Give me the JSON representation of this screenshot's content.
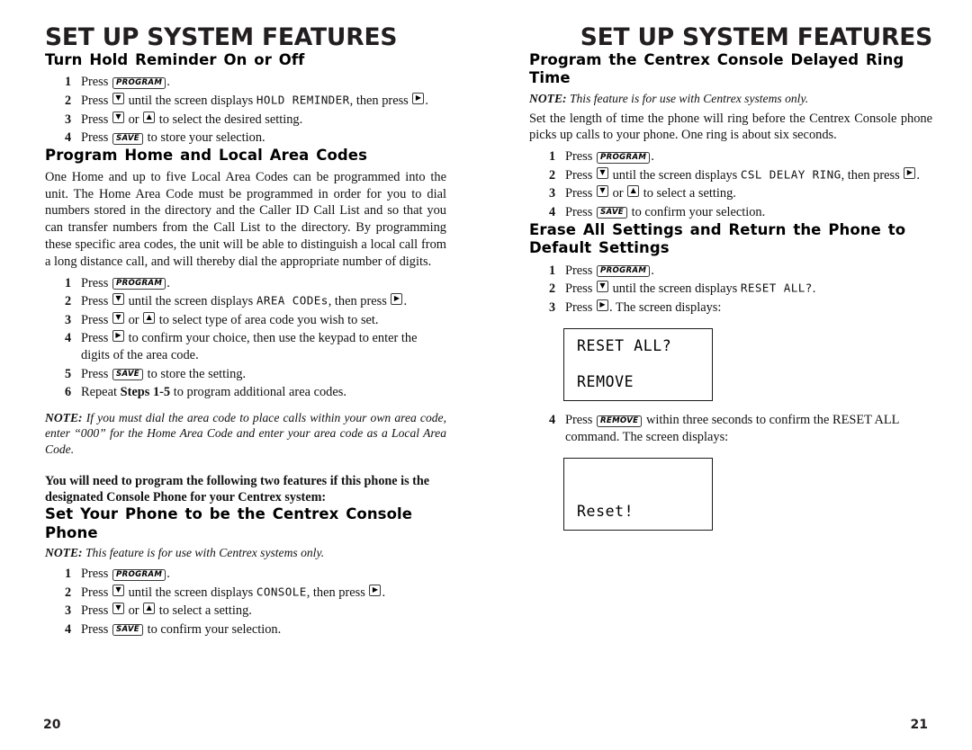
{
  "spread": {
    "left_page": {
      "running_head": "SET UP SYSTEM FEATURES",
      "folio": "20",
      "sections": [
        {
          "heading": "Turn Hold Reminder On or Off",
          "steps": [
            {
              "num": "1",
              "pre": "Press ",
              "key1": "PROGRAM",
              "mid": ".",
              "key2": "",
              "post": ""
            },
            {
              "num": "2",
              "pre": "Press ",
              "arrow": "down",
              "mid": " until the screen displays ",
              "lcd": "HOLD  REMINDER",
              "post": ", then press ",
              "arrow2": "right",
              "end": "."
            },
            {
              "num": "3",
              "pre": "Press ",
              "arrow": "down",
              "mid": " or ",
              "arrow2": "up",
              "post": " to select the desired setting."
            },
            {
              "num": "4",
              "pre": "Press ",
              "key1": "SAVE",
              "mid": " to store your selection."
            }
          ]
        },
        {
          "heading": "Program Home and Local Area Codes",
          "paragraph": "One Home and up to five Local Area Codes can be programmed into the unit. The Home Area Code must be programmed in order for you to dial numbers stored in the directory and the Caller ID Call List and so that you can transfer numbers from the Call List to the directory.  By programming these specific area codes, the unit will be able to distinguish a local call from a long distance call, and will thereby dial the appropriate number of digits.",
          "steps": [
            {
              "num": "1",
              "pre": "Press ",
              "key1": "PROGRAM",
              "mid": "."
            },
            {
              "num": "2",
              "pre": "Press ",
              "arrow": "down",
              "mid": " until the screen displays ",
              "lcd": "AREA  CODEs",
              "post": ", then press ",
              "arrow2": "right",
              "end": "."
            },
            {
              "num": "3",
              "pre": "Press ",
              "arrow": "down",
              "mid": " or ",
              "arrow2": "up",
              "post": " to select type of area code you wish to set."
            },
            {
              "num": "4",
              "pre": "Press ",
              "arrow": "right",
              "mid": " to confirm your choice, then use the keypad to enter the digits of the area code."
            },
            {
              "num": "5",
              "pre": "Press ",
              "key1": "SAVE",
              "mid": " to store the setting."
            },
            {
              "num": "6",
              "pre": "Repeat ",
              "bold": "Steps 1-5",
              "mid": " to program additional area codes."
            }
          ],
          "note_label": "NOTE:",
          "note_text": "If you must dial the area code to place calls within your own area code, enter “000” for the Home Area Code and enter your area code as a Local Area Code.",
          "callout": "You will need to program the following two features if this phone is the designated Console Phone for your Centrex system:"
        },
        {
          "heading": "Set Your Phone to be the Centrex Console Phone",
          "note_label": "NOTE:",
          "note_text": "This feature is for use with Centrex systems only.",
          "steps": [
            {
              "num": "1",
              "pre": "Press ",
              "key1": "PROGRAM",
              "mid": "."
            },
            {
              "num": "2",
              "pre": "Press ",
              "arrow": "down",
              "mid": " until the screen displays ",
              "lcd": "CONSOLE",
              "post": ", then press ",
              "arrow2": "right",
              "end": "."
            },
            {
              "num": "3",
              "pre": "Press ",
              "arrow": "down",
              "mid": " or ",
              "arrow2": "up",
              "post": " to select a setting."
            },
            {
              "num": "4",
              "pre": "Press ",
              "key1": "SAVE",
              "mid": " to confirm your selection."
            }
          ]
        }
      ]
    },
    "right_page": {
      "running_head": "SET UP SYSTEM FEATURES",
      "folio": "21",
      "sections": [
        {
          "heading": "Program the Centrex Console Delayed Ring Time",
          "note_label": "NOTE:",
          "note_text": "This feature is for use with Centrex systems only.",
          "paragraph": "Set the length of time the phone will ring before the Centrex Console phone picks up calls to your phone.  One ring is about six seconds.",
          "steps": [
            {
              "num": "1",
              "pre": "Press ",
              "key1": "PROGRAM",
              "mid": "."
            },
            {
              "num": "2",
              "pre": "Press ",
              "arrow": "down",
              "mid": " until the screen displays ",
              "lcd": "CSL  DELAY  RING",
              "post": ", then press ",
              "arrow2": "right",
              "end": "."
            },
            {
              "num": "3",
              "pre": "Press ",
              "arrow": "down",
              "mid": " or ",
              "arrow2": "up",
              "post": " to select a setting."
            },
            {
              "num": "4",
              "pre": "Press ",
              "key1": "SAVE",
              "mid": " to confirm your selection."
            }
          ]
        },
        {
          "heading": "Erase All Settings and Return the Phone to Default Settings",
          "steps": [
            {
              "num": "1",
              "pre": "Press ",
              "key1": "PROGRAM",
              "mid": "."
            },
            {
              "num": "2",
              "pre": "Press ",
              "arrow": "down",
              "mid": " until the screen displays ",
              "lcd": "RESET  ALL?",
              "post": "."
            },
            {
              "num": "3",
              "pre": "Press ",
              "arrow": "right",
              "mid": ". The screen displays:"
            }
          ],
          "lcd_box_1": {
            "line1": "RESET ALL?",
            "line2": "REMOVE"
          },
          "step4": {
            "num": "4",
            "pre": "Press ",
            "key1": "REMOVE",
            "mid": " within three seconds to confirm the RESET ALL command. The screen displays:"
          },
          "lcd_box_2": {
            "line1": "",
            "line2": "Reset!"
          }
        }
      ]
    }
  },
  "glyphs": {
    "arrow_down": "▼",
    "arrow_up": "▲",
    "arrow_right": "▶"
  }
}
